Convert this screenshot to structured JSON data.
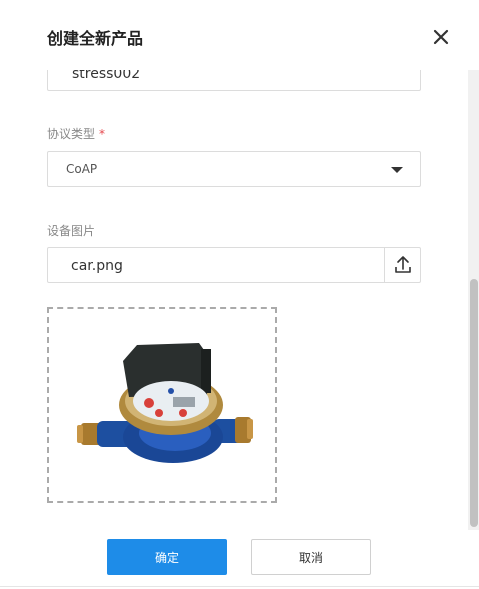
{
  "dialog": {
    "title": "创建全新产品"
  },
  "form": {
    "product_name_value": "stress002",
    "protocol_label": "协议类型",
    "protocol_required_mark": "*",
    "protocol_value": "CoAP",
    "image_label": "设备图片",
    "image_file_value": "car.png"
  },
  "footer": {
    "confirm_label": "确定",
    "cancel_label": "取消"
  },
  "colors": {
    "primary": "#1e8ce8",
    "required": "#e5484d"
  },
  "icons": {
    "close": "close-icon",
    "dropdown": "caret-down-icon",
    "upload": "upload-icon",
    "preview": "water-meter-image"
  }
}
